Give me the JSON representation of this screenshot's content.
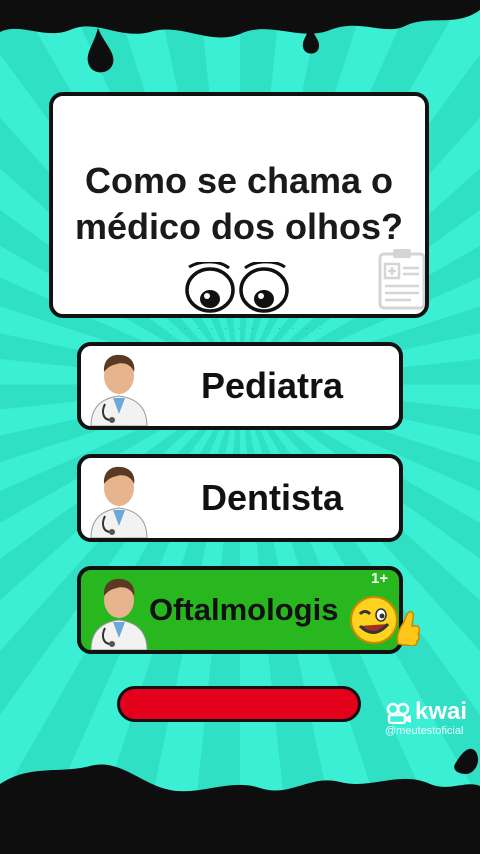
{
  "question": {
    "line1": "Como se chama o",
    "line2": "médico dos olhos?"
  },
  "answers": [
    {
      "label": "Pediatra",
      "correct": false
    },
    {
      "label": "Dentista",
      "correct": false
    },
    {
      "label": "Oftalmologis",
      "correct": true
    }
  ],
  "reward": {
    "points_text": "1+"
  },
  "branding": {
    "app_name": "kwai",
    "handle": "@meutestoficial"
  },
  "colors": {
    "background": "#33e8cc",
    "correct_answer": "#29b71f",
    "bar": "#e3001b",
    "ink": "#111111"
  },
  "icons": [
    "doctor-avatar-icon",
    "eyes-icon",
    "clipboard-icon",
    "wink-thumbs-up-emoji",
    "kwai-logo-icon"
  ]
}
